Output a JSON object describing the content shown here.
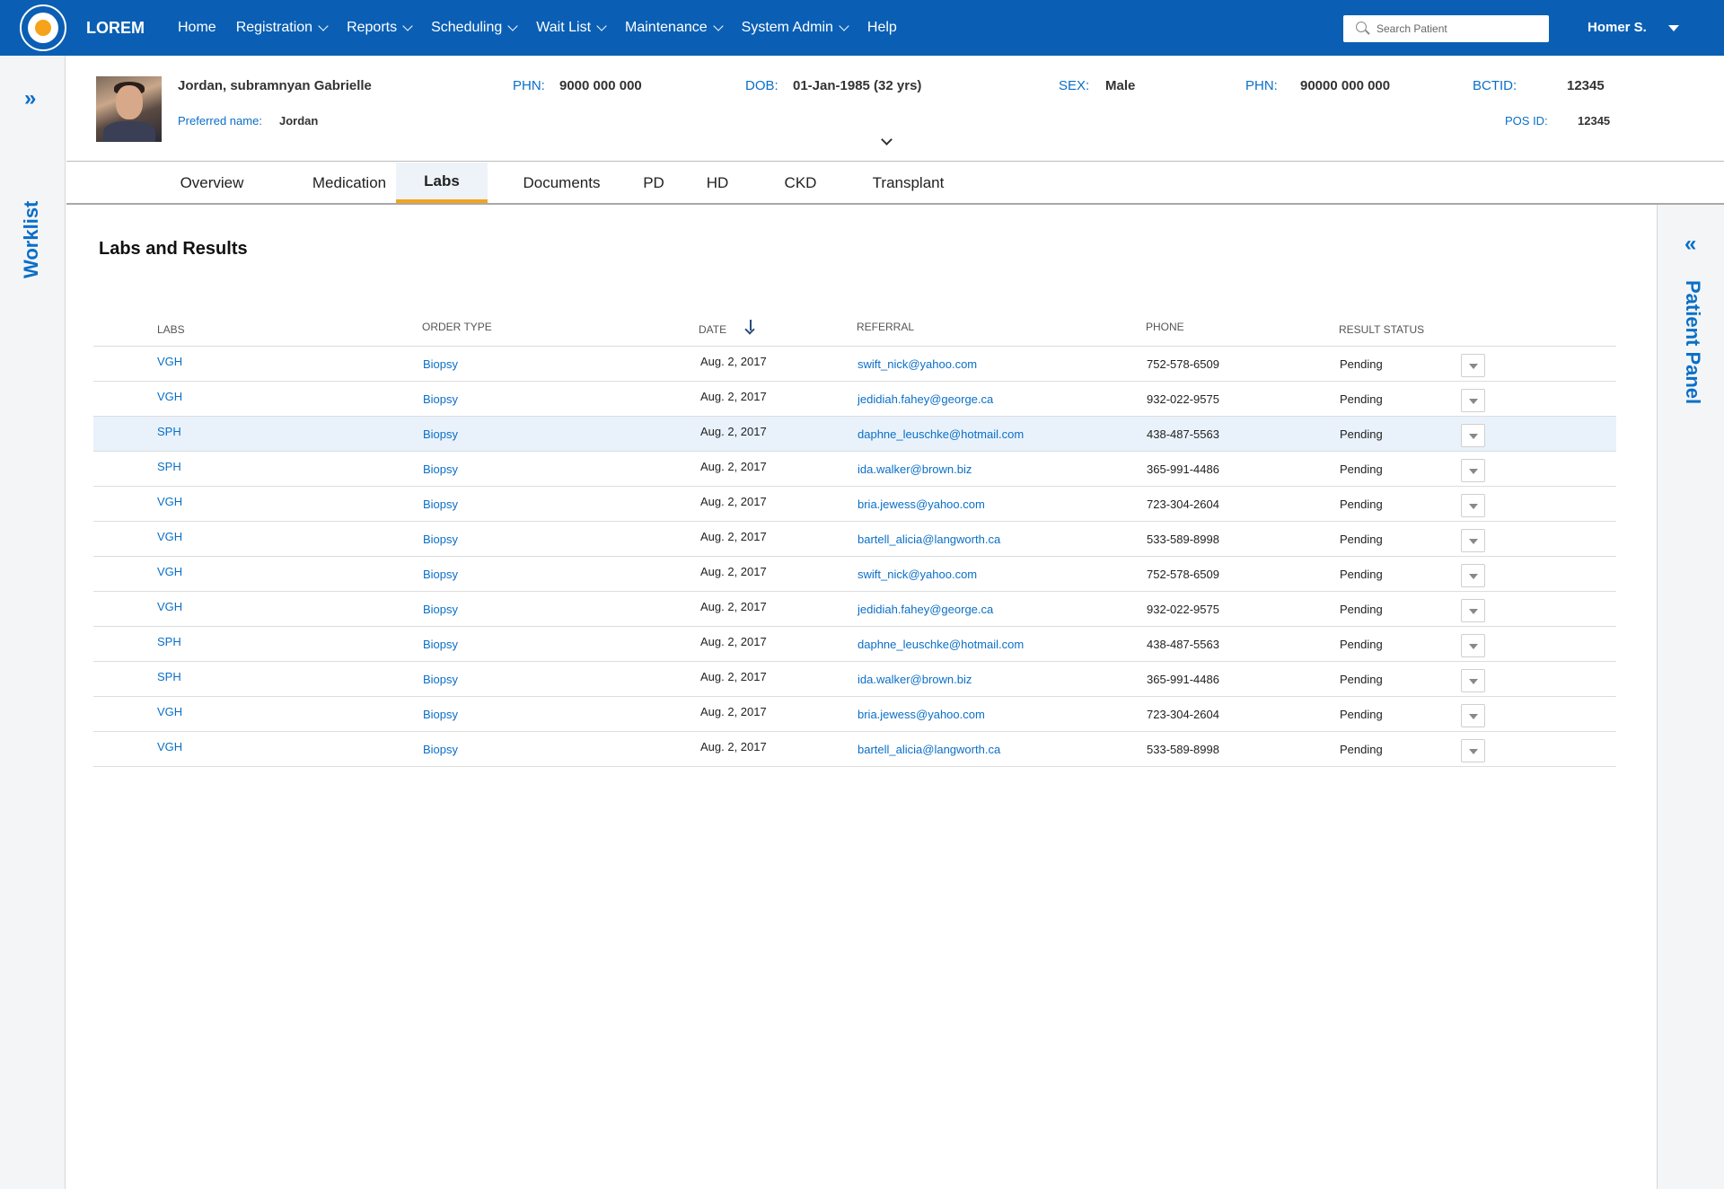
{
  "app": {
    "brand": "LOREM"
  },
  "nav": {
    "items": [
      {
        "label": "Home",
        "dropdown": false
      },
      {
        "label": "Registration",
        "dropdown": true
      },
      {
        "label": "Reports",
        "dropdown": true
      },
      {
        "label": "Scheduling",
        "dropdown": true
      },
      {
        "label": "Wait List",
        "dropdown": true
      },
      {
        "label": "Maintenance",
        "dropdown": true
      },
      {
        "label": "System Admin",
        "dropdown": true
      },
      {
        "label": "Help",
        "dropdown": false
      }
    ],
    "search_placeholder": "Search Patient",
    "user": "Homer S."
  },
  "left_sidebar": {
    "label": "Worklist",
    "icon": "double-chevron-right-icon"
  },
  "right_panel": {
    "label": "Patient Panel",
    "icon": "double-chevron-left-icon"
  },
  "patient": {
    "name": "Jordan, subramnyan Gabrielle",
    "preferred_label": "Preferred name:",
    "preferred_value": "Jordan",
    "phn1_label": "PHN:",
    "phn1_value": "9000 000 000",
    "dob_label": "DOB:",
    "dob_value": "01-Jan-1985 (32 yrs)",
    "sex_label": "SEX:",
    "sex_value": "Male",
    "phn2_label": "PHN:",
    "phn2_value": "90000 000 000",
    "bctid_label": "BCTID:",
    "bctid_value": "12345",
    "posid_label": "POS ID:",
    "posid_value": "12345"
  },
  "tabs": [
    {
      "label": "Overview",
      "active": false
    },
    {
      "label": "Medication",
      "active": false
    },
    {
      "label": "Labs",
      "active": true
    },
    {
      "label": "Documents",
      "active": false
    },
    {
      "label": "PD",
      "active": false
    },
    {
      "label": "HD",
      "active": false
    },
    {
      "label": "CKD",
      "active": false
    },
    {
      "label": "Transplant",
      "active": false
    }
  ],
  "main": {
    "title": "Labs and Results",
    "columns": {
      "labs": "LABS",
      "order_type": "ORDER TYPE",
      "date": "DATE",
      "referral": "REFERRAL",
      "phone": "PHONE",
      "result_status": "RESULT STATUS"
    },
    "rows": [
      {
        "lab": "VGH",
        "order": "Biopsy",
        "date": "Aug. 2, 2017",
        "referral": "swift_nick@yahoo.com",
        "phone": "752-578-6509",
        "status": "Pending"
      },
      {
        "lab": "VGH",
        "order": "Biopsy",
        "date": "Aug. 2, 2017",
        "referral": "jedidiah.fahey@george.ca",
        "phone": "932-022-9575",
        "status": "Pending"
      },
      {
        "lab": "SPH",
        "order": "Biopsy",
        "date": "Aug. 2, 2017",
        "referral": "daphne_leuschke@hotmail.com",
        "phone": "438-487-5563",
        "status": "Pending"
      },
      {
        "lab": "SPH",
        "order": "Biopsy",
        "date": "Aug. 2, 2017",
        "referral": "ida.walker@brown.biz",
        "phone": "365-991-4486",
        "status": "Pending"
      },
      {
        "lab": "VGH",
        "order": "Biopsy",
        "date": "Aug. 2, 2017",
        "referral": "bria.jewess@yahoo.com",
        "phone": "723-304-2604",
        "status": "Pending"
      },
      {
        "lab": "VGH",
        "order": "Biopsy",
        "date": "Aug. 2, 2017",
        "referral": "bartell_alicia@langworth.ca",
        "phone": "533-589-8998",
        "status": "Pending"
      },
      {
        "lab": "VGH",
        "order": "Biopsy",
        "date": "Aug. 2, 2017",
        "referral": "swift_nick@yahoo.com",
        "phone": "752-578-6509",
        "status": "Pending"
      },
      {
        "lab": "VGH",
        "order": "Biopsy",
        "date": "Aug. 2, 2017",
        "referral": "jedidiah.fahey@george.ca",
        "phone": "932-022-9575",
        "status": "Pending"
      },
      {
        "lab": "SPH",
        "order": "Biopsy",
        "date": "Aug. 2, 2017",
        "referral": "daphne_leuschke@hotmail.com",
        "phone": "438-487-5563",
        "status": "Pending"
      },
      {
        "lab": "SPH",
        "order": "Biopsy",
        "date": "Aug. 2, 2017",
        "referral": "ida.walker@brown.biz",
        "phone": "365-991-4486",
        "status": "Pending"
      },
      {
        "lab": "VGH",
        "order": "Biopsy",
        "date": "Aug. 2, 2017",
        "referral": "bria.jewess@yahoo.com",
        "phone": "723-304-2604",
        "status": "Pending"
      },
      {
        "lab": "VGH",
        "order": "Biopsy",
        "date": "Aug. 2, 2017",
        "referral": "bartell_alicia@langworth.ca",
        "phone": "533-589-8998",
        "status": "Pending"
      }
    ],
    "highlighted_row": 2
  },
  "colors": {
    "nav_bg": "#0a5fb4",
    "accent": "#f5a31a",
    "link": "#0a6fc7",
    "row_highlight": "#e9f2fb"
  }
}
